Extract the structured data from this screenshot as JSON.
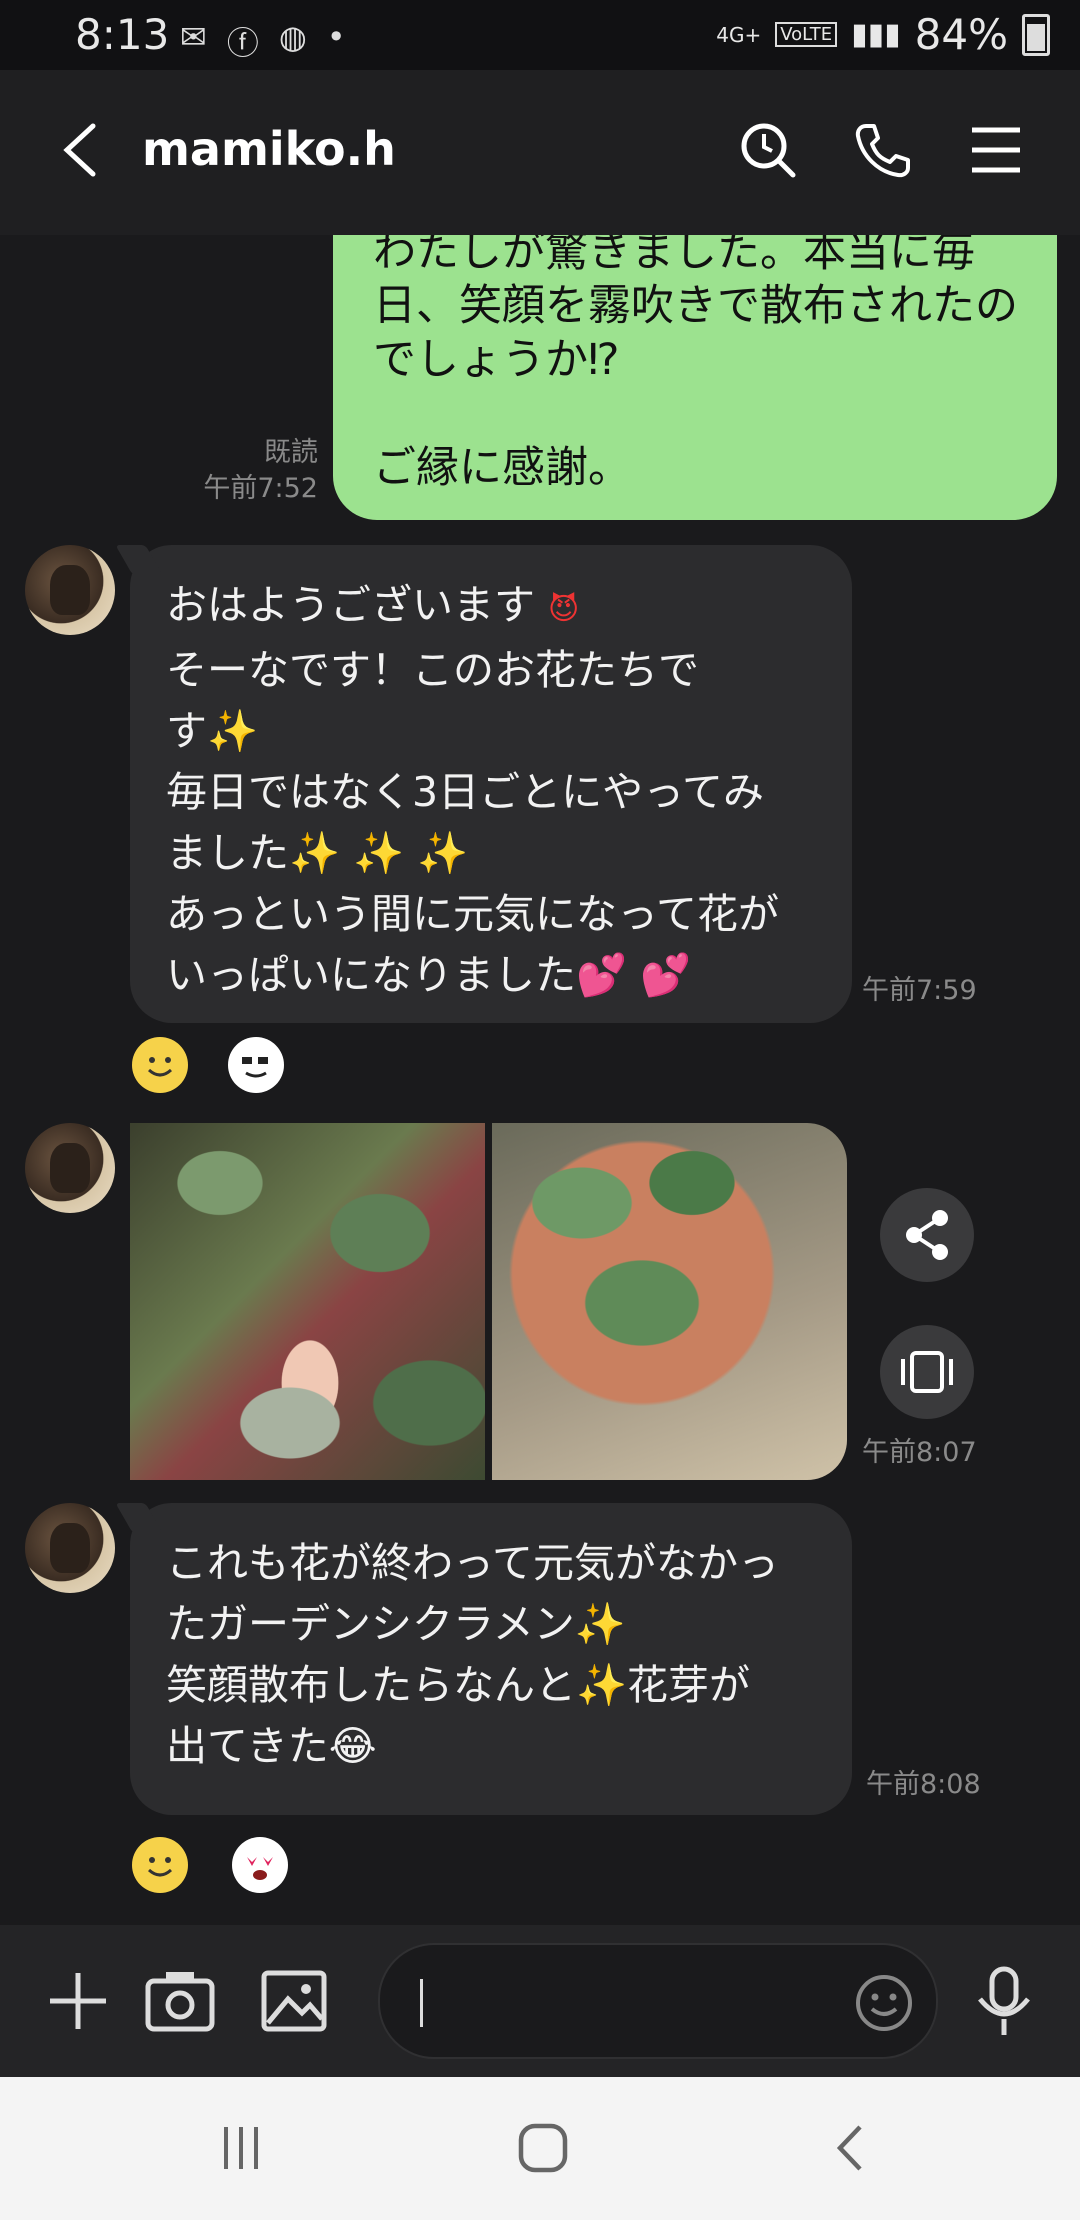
{
  "status_bar": {
    "time": "8:13",
    "network": "4G+",
    "volte": "VoLTE",
    "battery": "84%"
  },
  "header": {
    "contact_name": "mamiko.h",
    "icons": [
      "back-icon",
      "search-icon",
      "phone-icon",
      "menu-icon"
    ]
  },
  "messages": {
    "sent_1": {
      "lines": [
        "わたしが驚きました。本当に毎",
        "日、笑顔を霧吹きで散布されたの",
        "でしょうか⁉"
      ],
      "line_extra": "ご縁に感謝。",
      "read_label": "既読",
      "time": "午前7:52"
    },
    "recv_1": {
      "lines": [
        "おはようございます",
        "そーなです！このお花たちで",
        "す✨",
        "毎日ではなく3日ごとにやってみ",
        "ました✨ ✨ ✨",
        "あっという間に元気になって花が",
        "いっぱいになりました💕 💕"
      ],
      "time": "午前7:59"
    },
    "recv_photos": {
      "time": "午前8:07"
    },
    "recv_2": {
      "lines": [
        "これも花が終わって元気がなかっ",
        "たガーデンシクラメン✨",
        "笑顔散布したらなんと✨花芽が",
        "出てきた😂"
      ],
      "time": "午前8:08"
    }
  },
  "input": {
    "placeholder": ""
  },
  "colors": {
    "sent_bubble": "#9ce28f",
    "recv_bubble": "#2c2c2e",
    "background": "#1a1a1c"
  }
}
